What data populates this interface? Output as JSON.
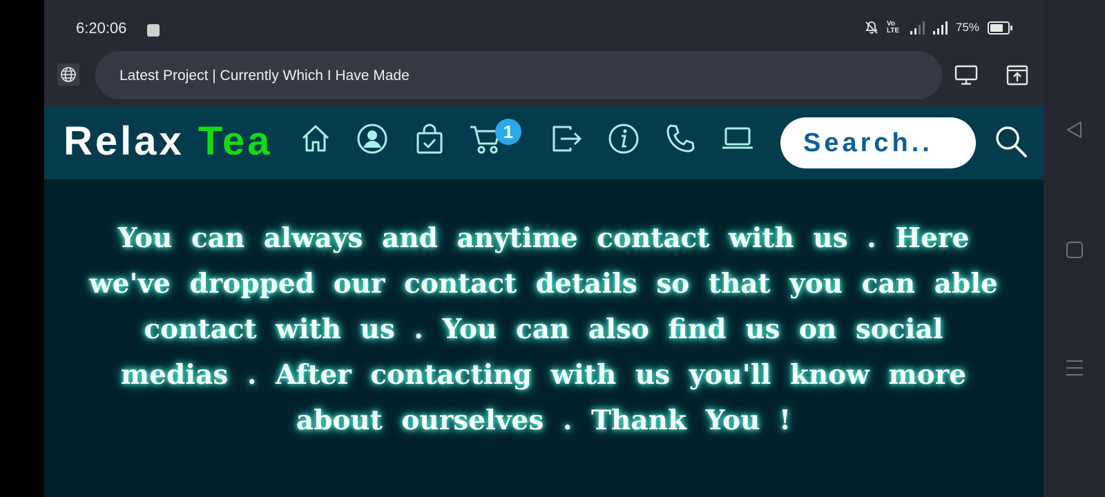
{
  "status_bar": {
    "time": "6:20:06",
    "volte": "Vo LTE",
    "battery": "75%"
  },
  "browser": {
    "url_title": "Latest Project | Currently Which I Have Made"
  },
  "site": {
    "logo_part1": "Relax",
    "logo_part2": "Tea",
    "cart_count": "1",
    "search_placeholder": "Search..",
    "nav_icons": [
      "home-icon",
      "user-icon",
      "shopping-bag-icon",
      "cart-icon",
      "logout-icon",
      "info-icon",
      "phone-icon",
      "laptop-icon",
      "search-icon"
    ],
    "logo_accent_color": "#14dc14",
    "icon_color": "#a8f0ec"
  },
  "hero": {
    "text": "You can always and anytime contact with us . Here we've dropped our contact details so that you can able contact with us . You can also find us on social medias . After contacting with us you'll know more about ourselves . Thank You !"
  }
}
